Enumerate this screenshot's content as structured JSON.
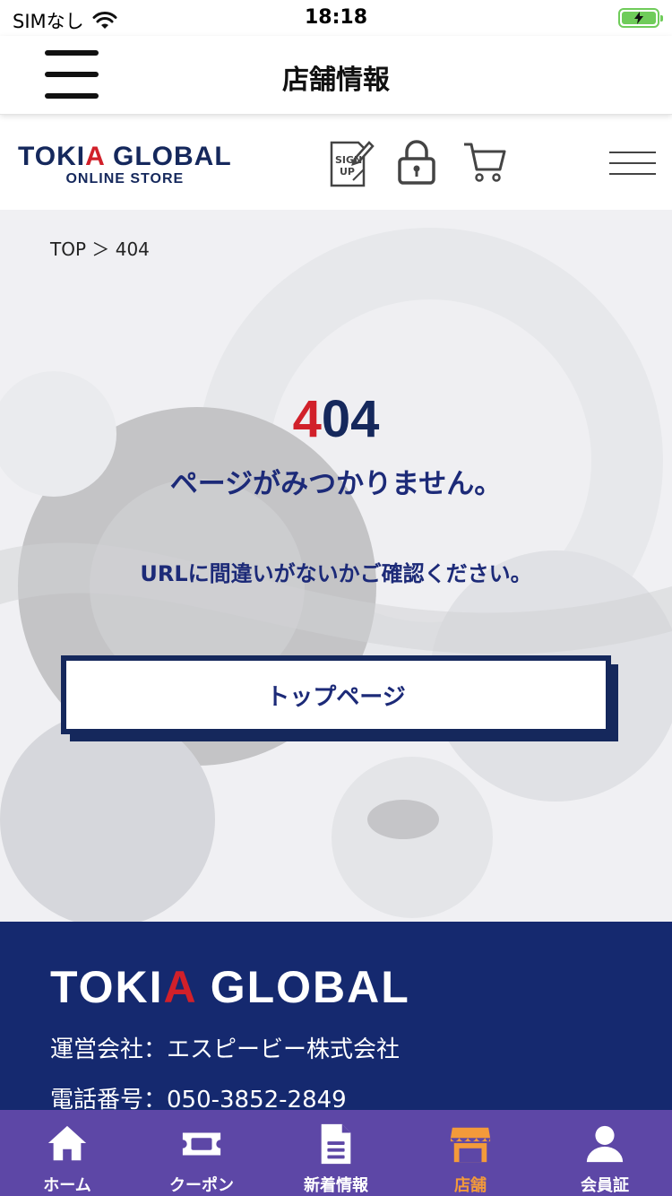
{
  "status_bar": {
    "carrier": "SIMなし",
    "time": "18:18"
  },
  "app_header": {
    "title": "店舗情報"
  },
  "site_header": {
    "logo_main_pre": "TOKI",
    "logo_main_accent": "A",
    "logo_main_post": " GLOBAL",
    "logo_sub": "ONLINE STORE",
    "icons": [
      "sign-up-icon",
      "lock-icon",
      "cart-icon",
      "menu-icon"
    ]
  },
  "main": {
    "breadcrumb": "TOP ＞ 404",
    "error_code_accent": "4",
    "error_code_rest": "04",
    "error_title": "ページがみつかりません。",
    "error_message": "URLに間違いがないかご確認ください。",
    "top_button": "トップページ"
  },
  "footer": {
    "logo_pre": "TOKI",
    "logo_accent": "A",
    "logo_post": " GLOBAL",
    "company": "運営会社：エスピービー株式会社",
    "phone": "電話番号：050-3852-2849"
  },
  "tabbar": {
    "items": [
      {
        "label": "ホーム",
        "icon": "home-icon"
      },
      {
        "label": "クーポン",
        "icon": "coupon-icon"
      },
      {
        "label": "新着情報",
        "icon": "news-icon"
      },
      {
        "label": "店舗",
        "icon": "store-icon",
        "active": true
      },
      {
        "label": "会員証",
        "icon": "member-icon"
      }
    ]
  },
  "colors": {
    "navy": "#15285c",
    "accent_red": "#d1202a",
    "tab_bg": "#5d47a6",
    "tab_active": "#f39a3a",
    "footer_bg": "#15296f"
  }
}
